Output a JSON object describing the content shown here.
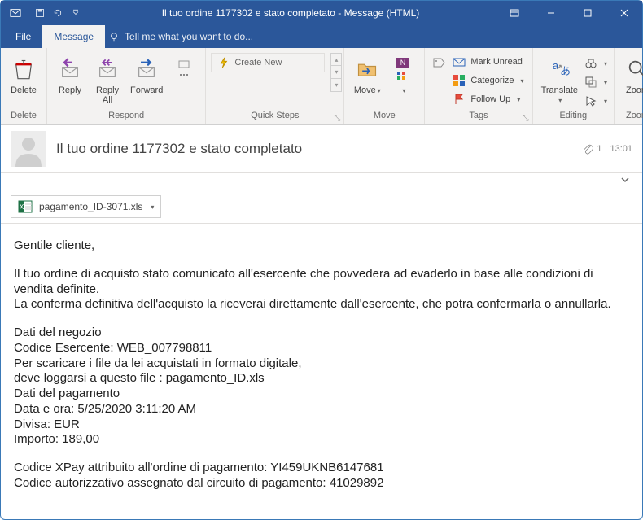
{
  "titlebar": {
    "title": "Il tuo ordine 1177302 e stato completato - Message (HTML)"
  },
  "menu": {
    "file": "File",
    "message": "Message",
    "tellme": "Tell me what you want to do..."
  },
  "ribbon": {
    "delete": {
      "label": "Delete",
      "group": "Delete"
    },
    "respond": {
      "reply": "Reply",
      "replyAll": "Reply\nAll",
      "forward": "Forward",
      "group": "Respond"
    },
    "quicksteps": {
      "createNew": "Create New",
      "group": "Quick Steps"
    },
    "move": {
      "label": "Move",
      "group": "Move"
    },
    "tags": {
      "markUnread": "Mark Unread",
      "categorize": "Categorize",
      "followUp": "Follow Up",
      "group": "Tags"
    },
    "editing": {
      "translate": "Translate",
      "group": "Editing"
    },
    "zoom": {
      "label": "Zoom",
      "group": "Zoom"
    }
  },
  "header": {
    "subject": "Il tuo ordine 1177302 e stato completato",
    "attachCount": "1",
    "time": "13:01"
  },
  "attachment": {
    "name": "pagamento_ID-3071.xls"
  },
  "bodyText": {
    "greeting": "Gentile cliente,",
    "p1": "Il tuo ordine di acquisto stato comunicato all'esercente che povvedera ad evaderlo in base alle condizioni di vendita definite.",
    "p2": "La conferma definitiva dell'acquisto la riceverai direttamente dall'esercente, che potra confermarla o annullarla.",
    "shopTitle": "Dati del negozio",
    "shopCode": "Codice Esercente: WEB_007798811",
    "dl1": "Per scaricare i file da lei acquistati in formato digitale,",
    "dl2": "deve loggarsi a questo file : pagamento_ID.xls",
    "payTitle": "Dati del pagamento",
    "datetime": "Data e ora: 5/25/2020  3:11:20 AM",
    "currency": "Divisa: EUR",
    "amount": "Importo: 189,00",
    "xpay": "Codice XPay attribuito all'ordine di pagamento: YI459UKNB6147681",
    "auth": "Codice autorizzativo assegnato dal circuito di pagamento: 41029892"
  }
}
